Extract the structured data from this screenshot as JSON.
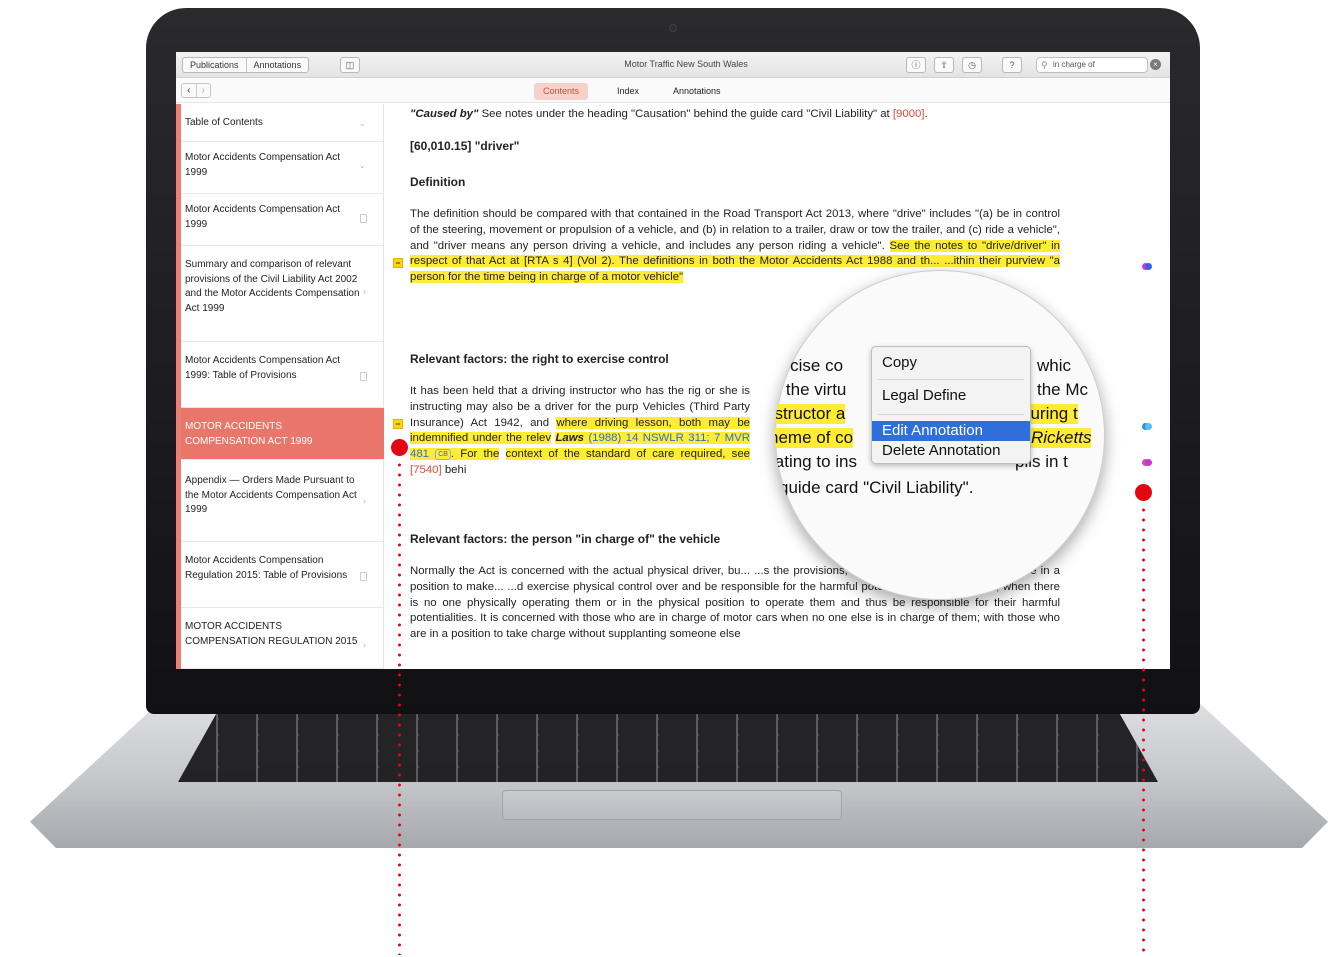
{
  "toolbar": {
    "publications_label": "Publications",
    "annotations_label": "Annotations",
    "title": "Motor Traffic New South Wales",
    "search_value": "in charge of"
  },
  "tabs": [
    {
      "label": "Contents",
      "active": true
    },
    {
      "label": "Index",
      "active": false
    },
    {
      "label": "Annotations",
      "active": false
    }
  ],
  "sidebar": {
    "items": [
      {
        "label": "Table of Contents"
      },
      {
        "label": "Motor Accidents Compensation Act 1999"
      },
      {
        "label": "Motor Accidents Compensation Act 1999"
      },
      {
        "label": "Summary and comparison of relevant provisions of the Civil Liability Act 2002 and the Motor Accidents Compensation Act 1999"
      },
      {
        "label": "Motor Accidents Compensation Act 1999: Table of Provisions"
      },
      {
        "label": "MOTOR ACCIDENTS COMPENSATION ACT 1999",
        "active": true
      },
      {
        "label": "Appendix — Orders Made Pursuant to the Motor Accidents Compensation Act 1999"
      },
      {
        "label": "Motor Accidents Compensation Regulation 2015: Table of Provisions"
      },
      {
        "label": "MOTOR ACCIDENTS COMPENSATION REGULATION 2015"
      }
    ]
  },
  "content": {
    "caused_by_em": "\"Caused by\"",
    "caused_by_rest": " See notes under the heading \"Causation\" behind the guide card \"Civil Liability\" at ",
    "caused_by_ref": "[9000]",
    "section_ref": "[60,010.15] \"driver\"",
    "definition_heading": "Definition",
    "def_para_plain": "The definition should be compared with that contained in the Road Transport Act 2013, where \"drive\" includes \"(a) be in control of the steering, movement or propulsion of a vehicle, and (b) in relation to a trailer, draw or tow the trailer, and (c) ride a vehicle\", and \"driver means any person driving a vehicle, and includes any person riding a vehicle\". ",
    "def_para_hl": "See the notes to \"drive/driver\" in respect of that Act at [RTA s 4] (Vol 2). The definitions in both the Motor Accidents Act 1988 and th... ...ithin their purview \"a person for the time being in charge of a motor vehicle\"",
    "heading_control": "Relevant factors: the right to exercise control",
    "control_para_plain": "It has been held that a driving instructor who has the rig or she is instructing may also be a driver for the purp Vehicles (Third Party Insurance) Act 1942, and ",
    "control_para_hl": "where driving lesson, both may be indemnified under the relev",
    "control_laws": "Laws",
    "control_cite": "(1988) 14 NSWLR 311; 7 MVR 481",
    "cb_label": "CB",
    "control_after": ". For the",
    "control_para_end": "context of the standard of care required, see ",
    "control_ref": "[7540]",
    "control_tail": " behi",
    "heading_charge": "Relevant factors: the person \"in charge of\" the vehicle",
    "charge_para": "Normally the Act is concerned with the actual physical driver, bu... ...s the provisions, where necessary, to \"those who are in a position to make... ...d exercise physical control over and be responsible for the harmful potentialities of motor cars, when there is no one physically operating them or in the physical position to operate them and thus be responsible for their harmful potentialities. It is concerned with those who are in charge of motor cars when no one else is in charge of them; with those who are in a position to take charge without supplanting someone else"
  },
  "magnifier": {
    "line1a": "ercise co",
    "line1b": "whic",
    "line2a": "of the virtu",
    "line2b": "the Mc",
    "line3a": "nstructor a",
    "line3b": "during t",
    "line4a": "heme of co",
    "line4b": "Ricketts",
    "line5a": "lating to ins",
    "line5b": "pils in t",
    "line6": "guide card \"Civil Liability\".",
    "menu": [
      "Copy",
      "Legal Define",
      "Edit Annotation",
      "Delete Annotation"
    ]
  },
  "colors": {
    "accent": "#e8766b",
    "highlight": "#ffec33",
    "callout": "#e30613",
    "menu_selected": "#2f6fdb"
  }
}
